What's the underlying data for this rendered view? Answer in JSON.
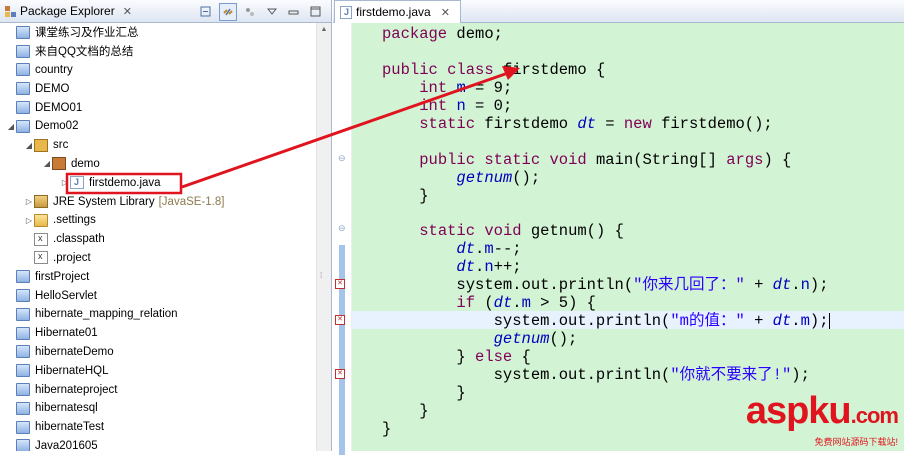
{
  "explorer": {
    "title": "Package Explorer",
    "close": "✕",
    "tree": [
      {
        "label": "课堂练习及作业汇总",
        "icon": "project-icon",
        "level": 0,
        "twisty": ""
      },
      {
        "label": "来自QQ文档的总结",
        "icon": "project-icon",
        "level": 0,
        "twisty": ""
      },
      {
        "label": "country",
        "icon": "project-icon",
        "level": 0,
        "twisty": ""
      },
      {
        "label": "DEMO",
        "icon": "project-icon",
        "level": 0,
        "twisty": ""
      },
      {
        "label": "DEMO01",
        "icon": "project-icon",
        "level": 0,
        "twisty": ""
      },
      {
        "label": "Demo02",
        "icon": "java-project-icon",
        "level": 0,
        "twisty": "◢"
      },
      {
        "label": "src",
        "icon": "source-folder-icon",
        "level": 1,
        "twisty": "◢"
      },
      {
        "label": "demo",
        "icon": "package-icon",
        "level": 2,
        "twisty": "◢"
      },
      {
        "label": "firstdemo.java",
        "icon": "java-file-icon",
        "level": 3,
        "twisty": "▷"
      },
      {
        "label": "JRE System Library",
        "icon": "library-icon",
        "level": 1,
        "twisty": "▷",
        "suffix": "[JavaSE-1.8]"
      },
      {
        "label": ".settings",
        "icon": "folder-icon",
        "level": 1,
        "twisty": "▷"
      },
      {
        "label": ".classpath",
        "icon": "xml-file-icon",
        "level": 1,
        "twisty": ""
      },
      {
        "label": ".project",
        "icon": "xml-file-icon",
        "level": 1,
        "twisty": ""
      },
      {
        "label": "firstProject",
        "icon": "project-icon",
        "level": 0,
        "twisty": ""
      },
      {
        "label": "HelloServlet",
        "icon": "project-icon",
        "level": 0,
        "twisty": ""
      },
      {
        "label": "hibernate_mapping_relation",
        "icon": "project-icon",
        "level": 0,
        "twisty": ""
      },
      {
        "label": "Hibernate01",
        "icon": "project-icon",
        "level": 0,
        "twisty": ""
      },
      {
        "label": "hibernateDemo",
        "icon": "project-icon",
        "level": 0,
        "twisty": ""
      },
      {
        "label": "HibernateHQL",
        "icon": "project-icon",
        "level": 0,
        "twisty": ""
      },
      {
        "label": "hibernateproject",
        "icon": "project-icon",
        "level": 0,
        "twisty": ""
      },
      {
        "label": "hibernatesql",
        "icon": "project-icon",
        "level": 0,
        "twisty": ""
      },
      {
        "label": "hibernateTest",
        "icon": "project-icon",
        "level": 0,
        "twisty": ""
      },
      {
        "label": "Java201605",
        "icon": "project-icon",
        "level": 0,
        "twisty": ""
      }
    ]
  },
  "editor": {
    "tab_title": "firstdemo.java",
    "close": "✕",
    "lines": [
      [
        [
          "package",
          "kw"
        ],
        [
          " demo;",
          ""
        ]
      ],
      [],
      [
        [
          "public",
          "kw"
        ],
        [
          " ",
          ""
        ],
        [
          "class",
          "kw"
        ],
        [
          " firstdemo {",
          ""
        ]
      ],
      [
        [
          "    ",
          ""
        ],
        [
          "int",
          "kw"
        ],
        [
          " ",
          ""
        ],
        [
          "m",
          "fld"
        ],
        [
          " = 9;",
          ""
        ]
      ],
      [
        [
          "    ",
          ""
        ],
        [
          "int",
          "kw"
        ],
        [
          " ",
          ""
        ],
        [
          "n",
          "fld"
        ],
        [
          " = 0;",
          ""
        ]
      ],
      [
        [
          "    ",
          ""
        ],
        [
          "static",
          "kw"
        ],
        [
          " firstdemo ",
          ""
        ],
        [
          "dt",
          "stat"
        ],
        [
          " = ",
          ""
        ],
        [
          "new",
          "kw"
        ],
        [
          " firstdemo();",
          ""
        ]
      ],
      [],
      [
        [
          "    ",
          ""
        ],
        [
          "public",
          "kw"
        ],
        [
          " ",
          ""
        ],
        [
          "static",
          "kw"
        ],
        [
          " ",
          ""
        ],
        [
          "void",
          "kw"
        ],
        [
          " main(String[] ",
          ""
        ],
        [
          "args",
          "kw"
        ],
        [
          ") {",
          ""
        ]
      ],
      [
        [
          "        ",
          ""
        ],
        [
          "getnum",
          "stat"
        ],
        [
          "();",
          ""
        ]
      ],
      [
        [
          "    }",
          ""
        ]
      ],
      [],
      [
        [
          "    ",
          ""
        ],
        [
          "static",
          "kw"
        ],
        [
          " ",
          ""
        ],
        [
          "void",
          "kw"
        ],
        [
          " getnum() {",
          ""
        ]
      ],
      [
        [
          "        ",
          ""
        ],
        [
          "dt",
          "stat"
        ],
        [
          ".",
          ""
        ],
        [
          "m",
          "fld"
        ],
        [
          "--;",
          ""
        ]
      ],
      [
        [
          "        ",
          ""
        ],
        [
          "dt",
          "stat"
        ],
        [
          ".",
          ""
        ],
        [
          "n",
          "fld"
        ],
        [
          "++;",
          ""
        ]
      ],
      [
        [
          "        system.out.println(",
          ""
        ],
        [
          "\"你来几回了：\"",
          "str"
        ],
        [
          " + ",
          ""
        ],
        [
          "dt",
          "stat"
        ],
        [
          ".",
          ""
        ],
        [
          "n",
          "fld"
        ],
        [
          ");",
          ""
        ]
      ],
      [
        [
          "        ",
          ""
        ],
        [
          "if",
          "kw"
        ],
        [
          " (",
          ""
        ],
        [
          "dt",
          "stat"
        ],
        [
          ".",
          ""
        ],
        [
          "m",
          "fld"
        ],
        [
          " > 5) {",
          ""
        ]
      ],
      [
        [
          "            system.out.println(",
          ""
        ],
        [
          "\"m的值：\"",
          "str"
        ],
        [
          " + ",
          ""
        ],
        [
          "dt",
          "stat"
        ],
        [
          ".",
          ""
        ],
        [
          "m",
          "fld"
        ],
        [
          ");",
          ""
        ]
      ],
      [
        [
          "            ",
          ""
        ],
        [
          "getnum",
          "stat"
        ],
        [
          "();",
          ""
        ]
      ],
      [
        [
          "        } ",
          ""
        ],
        [
          "else",
          "kw"
        ],
        [
          " {",
          ""
        ]
      ],
      [
        [
          "            system.out.println(",
          ""
        ],
        [
          "\"你就不要来了!\"",
          "str"
        ],
        [
          ");",
          ""
        ]
      ],
      [
        [
          "        }",
          ""
        ]
      ],
      [
        [
          "    }",
          ""
        ]
      ],
      [
        [
          "}",
          ""
        ]
      ]
    ]
  },
  "watermark": {
    "brand": "aspku",
    "suffix": ".com",
    "sub": "免费网站源码下载站!"
  },
  "colors": {
    "editor_bg": "#d3f3d5",
    "keyword": "#7f0055",
    "field": "#0000c0",
    "string": "#2a00ff",
    "annotation_red": "#e0141e"
  }
}
